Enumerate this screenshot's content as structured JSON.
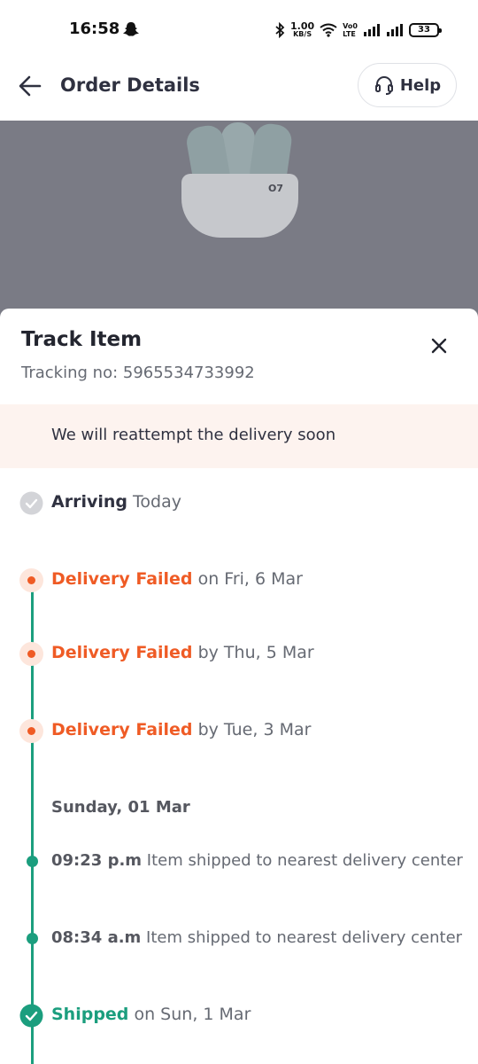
{
  "status_bar": {
    "time": "16:58",
    "net_speed_value": "1.00",
    "net_speed_unit": "KB/S",
    "volte_top": "Vo0",
    "volte_bottom": "LTE",
    "battery": "33"
  },
  "header": {
    "title": "Order Details",
    "help_label": "Help"
  },
  "banner": {
    "case_logo": "O7"
  },
  "sheet": {
    "title": "Track Item",
    "tracking_no": "Tracking no: 5965534733992",
    "notice": "We will reattempt the delivery soon",
    "arriving_label": "Arriving",
    "arriving_when": "Today"
  },
  "timeline": {
    "failed_1_status": "Delivery Failed",
    "failed_1_date": "on Fri, 6 Mar",
    "failed_2_status": "Delivery Failed",
    "failed_2_date": "by Thu, 5 Mar",
    "failed_3_status": "Delivery Failed",
    "failed_3_date": "by Tue, 3 Mar",
    "date_header": "Sunday, 01 Mar",
    "update_1_time": "09:23 p.m",
    "update_1_text": "Item shipped to nearest delivery center",
    "update_2_time": "08:34 a.m",
    "update_2_text": "Item shipped to nearest delivery center",
    "shipped_status": "Shipped",
    "shipped_date": "on Sun, 1 Mar"
  },
  "colors": {
    "failed": "#ef5b25",
    "success": "#1b9e7e",
    "notice_bg": "#fdf3ef"
  },
  "icons": [
    "snapchat-icon",
    "bluetooth-icon",
    "wifi-icon",
    "signal-icon",
    "battery-icon",
    "back-arrow-icon",
    "headset-icon",
    "close-icon",
    "check-circle-icon"
  ]
}
